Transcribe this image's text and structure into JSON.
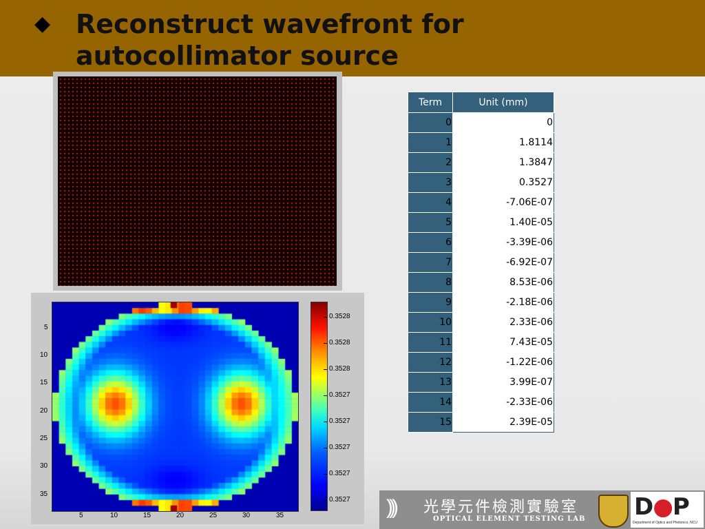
{
  "slide": {
    "title": "Reconstruct wavefront for autocollimator source",
    "bullet": "◆"
  },
  "dot_image": {
    "description_icon": "dot-grid-image",
    "colors": {
      "background": "#150000",
      "dot": "#a51a1a"
    }
  },
  "heatmap": {
    "y_ticks": [
      "5",
      "10",
      "15",
      "20",
      "25",
      "30",
      "35"
    ],
    "x_ticks": [
      "5",
      "10",
      "15",
      "20",
      "25",
      "30",
      "35"
    ],
    "colorbar_ticks": [
      "0.3528",
      "0.3528",
      "0.3528",
      "0.3527",
      "0.3527",
      "0.3527",
      "0.3527",
      "0.3527"
    ]
  },
  "table": {
    "headers": [
      "Term",
      "Unit (mm)"
    ],
    "rows": [
      {
        "term": "0",
        "value": "0"
      },
      {
        "term": "1",
        "value": "1.8114"
      },
      {
        "term": "2",
        "value": "1.3847"
      },
      {
        "term": "3",
        "value": "0.3527"
      },
      {
        "term": "4",
        "value": "-7.06E-07"
      },
      {
        "term": "5",
        "value": "1.40E-05"
      },
      {
        "term": "6",
        "value": "-3.39E-06"
      },
      {
        "term": "7",
        "value": "-6.92E-07"
      },
      {
        "term": "8",
        "value": "8.53E-06"
      },
      {
        "term": "9",
        "value": "-2.18E-06"
      },
      {
        "term": "10",
        "value": "2.33E-06"
      },
      {
        "term": "11",
        "value": "7.43E-05"
      },
      {
        "term": "12",
        "value": "-1.22E-06"
      },
      {
        "term": "13",
        "value": "3.99E-07"
      },
      {
        "term": "14",
        "value": "-2.33E-06"
      },
      {
        "term": "15",
        "value": "2.39E-05"
      }
    ]
  },
  "footer": {
    "lab_name_cn": "光學元件檢測實驗室",
    "lab_name_en": "OPTICAL ELEMENT TESTING LAB",
    "dop_logo": "DOP",
    "dop_subtitle": "Department of Optics and Photonics, NCU"
  },
  "colors": {
    "title_bar": "#966400",
    "table_header": "#33607a"
  }
}
